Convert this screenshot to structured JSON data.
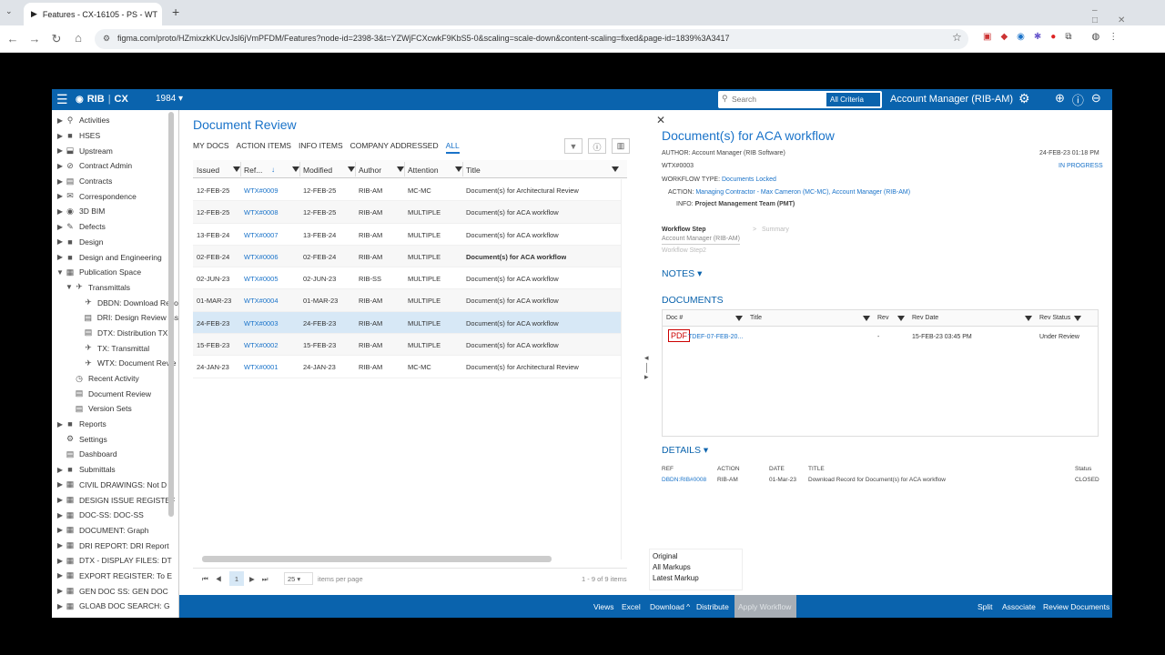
{
  "browser": {
    "tab_title": "Features - CX-16105 - PS - WT",
    "url": "figma.com/proto/HZmixzkKUcvJsl6jVmPFDM/Features?node-id=2398-3&t=YZWjFCXcwkF9KbS5-0&scaling=scale-down&content-scaling=fixed&page-id=1839%3A3417"
  },
  "app": {
    "brand": "RIB",
    "product": "CX",
    "project": "1984 ▾",
    "search_placeholder": "Search",
    "all_criteria": "All Criteria",
    "role": "Account Manager (RIB-AM)"
  },
  "sidebar": {
    "items": [
      {
        "label": "Activities",
        "arrow": "▶",
        "icon": "⚲",
        "indent": 0
      },
      {
        "label": "HSES",
        "arrow": "▶",
        "icon": "■",
        "indent": 0
      },
      {
        "label": "Upstream",
        "arrow": "▶",
        "icon": "⬓",
        "indent": 0
      },
      {
        "label": "Contract Admin",
        "arrow": "▶",
        "icon": "⊘",
        "indent": 0
      },
      {
        "label": "Contracts",
        "arrow": "▶",
        "icon": "▤",
        "indent": 0
      },
      {
        "label": "Correspondence",
        "arrow": "▶",
        "icon": "✉",
        "indent": 0
      },
      {
        "label": "3D BIM",
        "arrow": "▶",
        "icon": "◉",
        "indent": 0
      },
      {
        "label": "Defects",
        "arrow": "▶",
        "icon": "✎",
        "indent": 0
      },
      {
        "label": "Design",
        "arrow": "▶",
        "icon": "■",
        "indent": 0
      },
      {
        "label": "Design and Engineering",
        "arrow": "▶",
        "icon": "■",
        "indent": 0
      },
      {
        "label": "Publication Space",
        "arrow": "▼",
        "icon": "▦",
        "indent": 0
      },
      {
        "label": "Transmittals",
        "arrow": "▼",
        "icon": "✈",
        "indent": 1
      },
      {
        "label": "DBDN: Download Reco",
        "arrow": "",
        "icon": "✈",
        "indent": 2
      },
      {
        "label": "DRI: Design Review Iss",
        "arrow": "",
        "icon": "▤",
        "indent": 2
      },
      {
        "label": "DTX: Distribution TX",
        "arrow": "",
        "icon": "▤",
        "indent": 2
      },
      {
        "label": "TX: Transmittal",
        "arrow": "",
        "icon": "✈",
        "indent": 2
      },
      {
        "label": "WTX: Document Revie",
        "arrow": "",
        "icon": "✈",
        "indent": 2
      },
      {
        "label": "Recent Activity",
        "arrow": "",
        "icon": "◷",
        "indent": 1
      },
      {
        "label": "Document Review",
        "arrow": "",
        "icon": "▤",
        "indent": 1
      },
      {
        "label": "Version Sets",
        "arrow": "",
        "icon": "▤",
        "indent": 1
      },
      {
        "label": "Reports",
        "arrow": "▶",
        "icon": "■",
        "indent": 0
      },
      {
        "label": "Settings",
        "arrow": "",
        "icon": "⚙",
        "indent": 0
      },
      {
        "label": "Dashboard",
        "arrow": "",
        "icon": "▤",
        "indent": 0
      },
      {
        "label": "Submittals",
        "arrow": "▶",
        "icon": "■",
        "indent": 0
      },
      {
        "label": "CIVIL DRAWINGS: Not D",
        "arrow": "▶",
        "icon": "▦",
        "indent": 0
      },
      {
        "label": "DESIGN ISSUE REGISTEF",
        "arrow": "▶",
        "icon": "▦",
        "indent": 0
      },
      {
        "label": "DOC-SS: DOC-SS",
        "arrow": "▶",
        "icon": "▦",
        "indent": 0
      },
      {
        "label": "DOCUMENT: Graph",
        "arrow": "▶",
        "icon": "▦",
        "indent": 0
      },
      {
        "label": "DRI REPORT: DRI Report",
        "arrow": "▶",
        "icon": "▦",
        "indent": 0
      },
      {
        "label": "DTX - DISPLAY FILES: DT",
        "arrow": "▶",
        "icon": "▦",
        "indent": 0
      },
      {
        "label": "EXPORT REGISTER: To E",
        "arrow": "▶",
        "icon": "▦",
        "indent": 0
      },
      {
        "label": "GEN DOC SS: GEN DOC",
        "arrow": "▶",
        "icon": "▦",
        "indent": 0
      },
      {
        "label": "GLOAB DOC SEARCH: G",
        "arrow": "▶",
        "icon": "▦",
        "indent": 0
      }
    ]
  },
  "review": {
    "title": "Document Review",
    "tabs": [
      "MY DOCS",
      "ACTION ITEMS",
      "INFO ITEMS",
      "COMPANY ADDRESSED",
      "ALL"
    ],
    "columns": [
      "Issued",
      "Ref...",
      "Modified",
      "Author",
      "Attention",
      "Title"
    ],
    "rows": [
      [
        "12-FEB-25",
        "WTX#0009",
        "12-FEB-25",
        "RIB-AM",
        "MC-MC",
        "Document(s) for Architectural Review"
      ],
      [
        "12-FEB-25",
        "WTX#0008",
        "12-FEB-25",
        "RIB-AM",
        "MULTIPLE",
        "Document(s) for ACA workflow"
      ],
      [
        "13-FEB-24",
        "WTX#0007",
        "13-FEB-24",
        "RIB-AM",
        "MULTIPLE",
        "Document(s) for ACA workflow"
      ],
      [
        "02-FEB-24",
        "WTX#0006",
        "02-FEB-24",
        "RIB-AM",
        "MULTIPLE",
        "Document(s) for ACA workflow"
      ],
      [
        "02-JUN-23",
        "WTX#0005",
        "02-JUN-23",
        "RIB-SS",
        "MULTIPLE",
        "Document(s) for ACA workflow"
      ],
      [
        "01-MAR-23",
        "WTX#0004",
        "01-MAR-23",
        "RIB-AM",
        "MULTIPLE",
        "Document(s) for ACA workflow"
      ],
      [
        "24-FEB-23",
        "WTX#0003",
        "24-FEB-23",
        "RIB-AM",
        "MULTIPLE",
        "Document(s) for ACA workflow"
      ],
      [
        "15-FEB-23",
        "WTX#0002",
        "15-FEB-23",
        "RIB-AM",
        "MULTIPLE",
        "Document(s) for ACA workflow"
      ],
      [
        "24-JAN-23",
        "WTX#0001",
        "24-JAN-23",
        "RIB-AM",
        "MC-MC",
        "Document(s) for Architectural Review"
      ]
    ],
    "selected_row": 6,
    "bold_row": 3,
    "pager": {
      "page": "1",
      "per_page": "25",
      "items_label": "items per page",
      "count": "1 - 9 of 9 items"
    }
  },
  "detail": {
    "title": "Document(s) for ACA workflow",
    "author_label": "AUTHOR:",
    "author": "Account Manager (RIB Software)",
    "date": "24-FEB-23 01:18 PM",
    "ref": "WTX#0003",
    "status": "IN PROGRESS",
    "wf_type_label": "WORKFLOW TYPE:",
    "wf_type": "Documents Locked",
    "action_label": "ACTION:",
    "action": "Managing Contractor - Max Cameron (MC-MC), Account Manager (RIB-AM)",
    "info_label": "INFO:",
    "info": "Project Management Team (PMT)",
    "wf_step": "Workflow Step",
    "wf_step_who": "Account Manager (RIB-AM)",
    "wf_step_next": "Workflow Step2",
    "summary": "Summary",
    "notes": "NOTES",
    "documents": "DOCUMENTS",
    "doc_cols": [
      "Doc #",
      "Title",
      "Rev",
      "Rev Date",
      "Rev Status"
    ],
    "doc_row": [
      "TDEF-07-FEB-20...",
      "",
      "-",
      "15-FEB-23 03:45 PM",
      "Under Review"
    ],
    "details": "DETAILS",
    "det_cols": [
      "REF",
      "ACTION",
      "DATE",
      "TITLE",
      "Status"
    ],
    "det_row": [
      "DBDN:RIB#0008",
      "RIB-AM",
      "01-Mar-23",
      "Download Record for Document(s) for ACA workflow",
      "CLOSED"
    ]
  },
  "popup": [
    "Original",
    "All Markups",
    "Latest Markup"
  ],
  "bottom": {
    "views": "Views",
    "excel": "Excel",
    "download": "Download ^",
    "distribute": "Distribute",
    "apply": "Apply Workflow",
    "split": "Split",
    "associate": "Associate",
    "review": "Review Documents"
  }
}
